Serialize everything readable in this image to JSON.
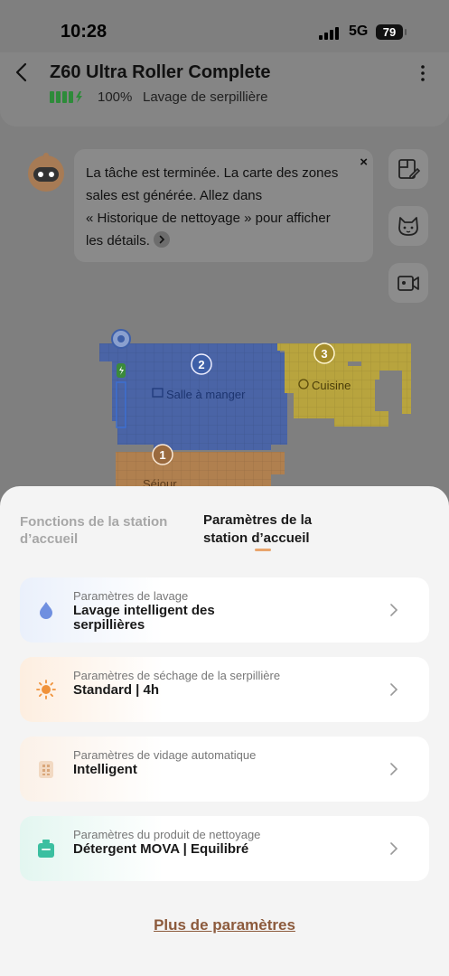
{
  "status_bar": {
    "time": "10:28",
    "network": "5G",
    "battery": "79"
  },
  "header": {
    "title": "Z60 Ultra Roller Complete",
    "battery_percent": "100%",
    "mode": "Lavage de serpillière"
  },
  "notification": {
    "message_lines": [
      "La tâche est terminée. La carte des zones",
      "sales est générée. Allez dans",
      "« Historique de nettoyage » pour afficher",
      "les détails."
    ],
    "close": "×"
  },
  "side_buttons": [
    "edit-map-icon",
    "pet-icon",
    "camera-icon"
  ],
  "map": {
    "rooms": [
      {
        "number": "2",
        "name": "Salle à manger",
        "color": "#5571b8"
      },
      {
        "number": "3",
        "name": "Cuisine",
        "color": "#c3b048"
      },
      {
        "number": "1",
        "name": "Séjour",
        "color": "#b9875a"
      }
    ]
  },
  "sheet": {
    "tabs": [
      {
        "label": "Fonctions de la station d’accueil",
        "active": false
      },
      {
        "label": "Paramètres de la station d’accueil",
        "active": true
      }
    ],
    "cards": [
      {
        "label": "Paramètres de lavage",
        "value": "Lavage intelligent des serpillières",
        "icon": "water-drop-icon"
      },
      {
        "label": "Paramètres de séchage de la serpillière",
        "value": "Standard | 4h",
        "icon": "sun-icon"
      },
      {
        "label": "Paramètres de vidage automatique",
        "value": "Intelligent",
        "icon": "dust-bag-icon"
      },
      {
        "label": "Paramètres du produit de nettoyage",
        "value": "Détergent MOVA | Equilibré",
        "icon": "detergent-icon"
      }
    ],
    "more_link": "Plus de paramètres"
  },
  "colors": {
    "accent": "#e8a46c",
    "link": "#8c5a3c",
    "battery_green": "#4caf50"
  }
}
